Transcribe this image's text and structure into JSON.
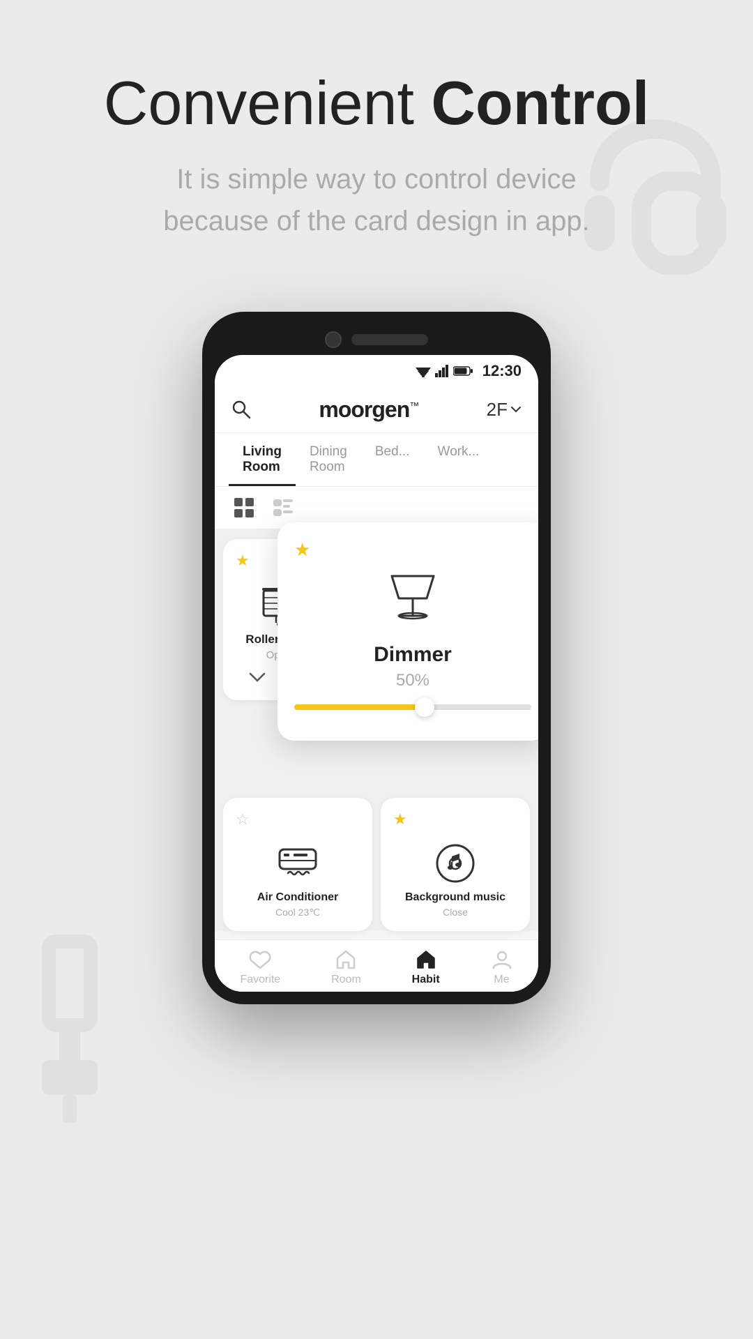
{
  "hero": {
    "title_light": "Convenient ",
    "title_bold": "Control",
    "subtitle_line1": "It is simple way to control device",
    "subtitle_line2": "because of the card design in app."
  },
  "status_bar": {
    "time": "12:30"
  },
  "app_bar": {
    "logo_light": "moor",
    "logo_bold": "gen",
    "logo_tm": "™",
    "floor": "2F",
    "search_icon": "search"
  },
  "rooms": [
    {
      "label": "Living\nRoom",
      "active": true
    },
    {
      "label": "Dining\nRoom",
      "active": false
    },
    {
      "label": "Bed...",
      "active": false
    },
    {
      "label": "Work...",
      "active": false
    }
  ],
  "dimmer_card": {
    "star": "★",
    "name": "Dimmer",
    "percent": "50%",
    "slider_fill_pct": 55
  },
  "roller_blind_card": {
    "star": "★",
    "name": "Roller Blind",
    "status": "Open"
  },
  "air_conditioner_card": {
    "star_empty": "☆",
    "name": "Air Conditioner",
    "status": "Cool 23℃"
  },
  "bg_music_card": {
    "star": "★",
    "name": "Background music",
    "status": "Close"
  },
  "bottom_nav": [
    {
      "label": "Favorite",
      "active": false
    },
    {
      "label": "Room",
      "active": false
    },
    {
      "label": "Habit",
      "active": true
    },
    {
      "label": "Me",
      "active": false
    }
  ],
  "colors": {
    "accent": "#f5c518",
    "text_primary": "#222222",
    "text_secondary": "#aaaaaa",
    "card_bg": "#ffffff",
    "bg": "#ebebeb"
  }
}
